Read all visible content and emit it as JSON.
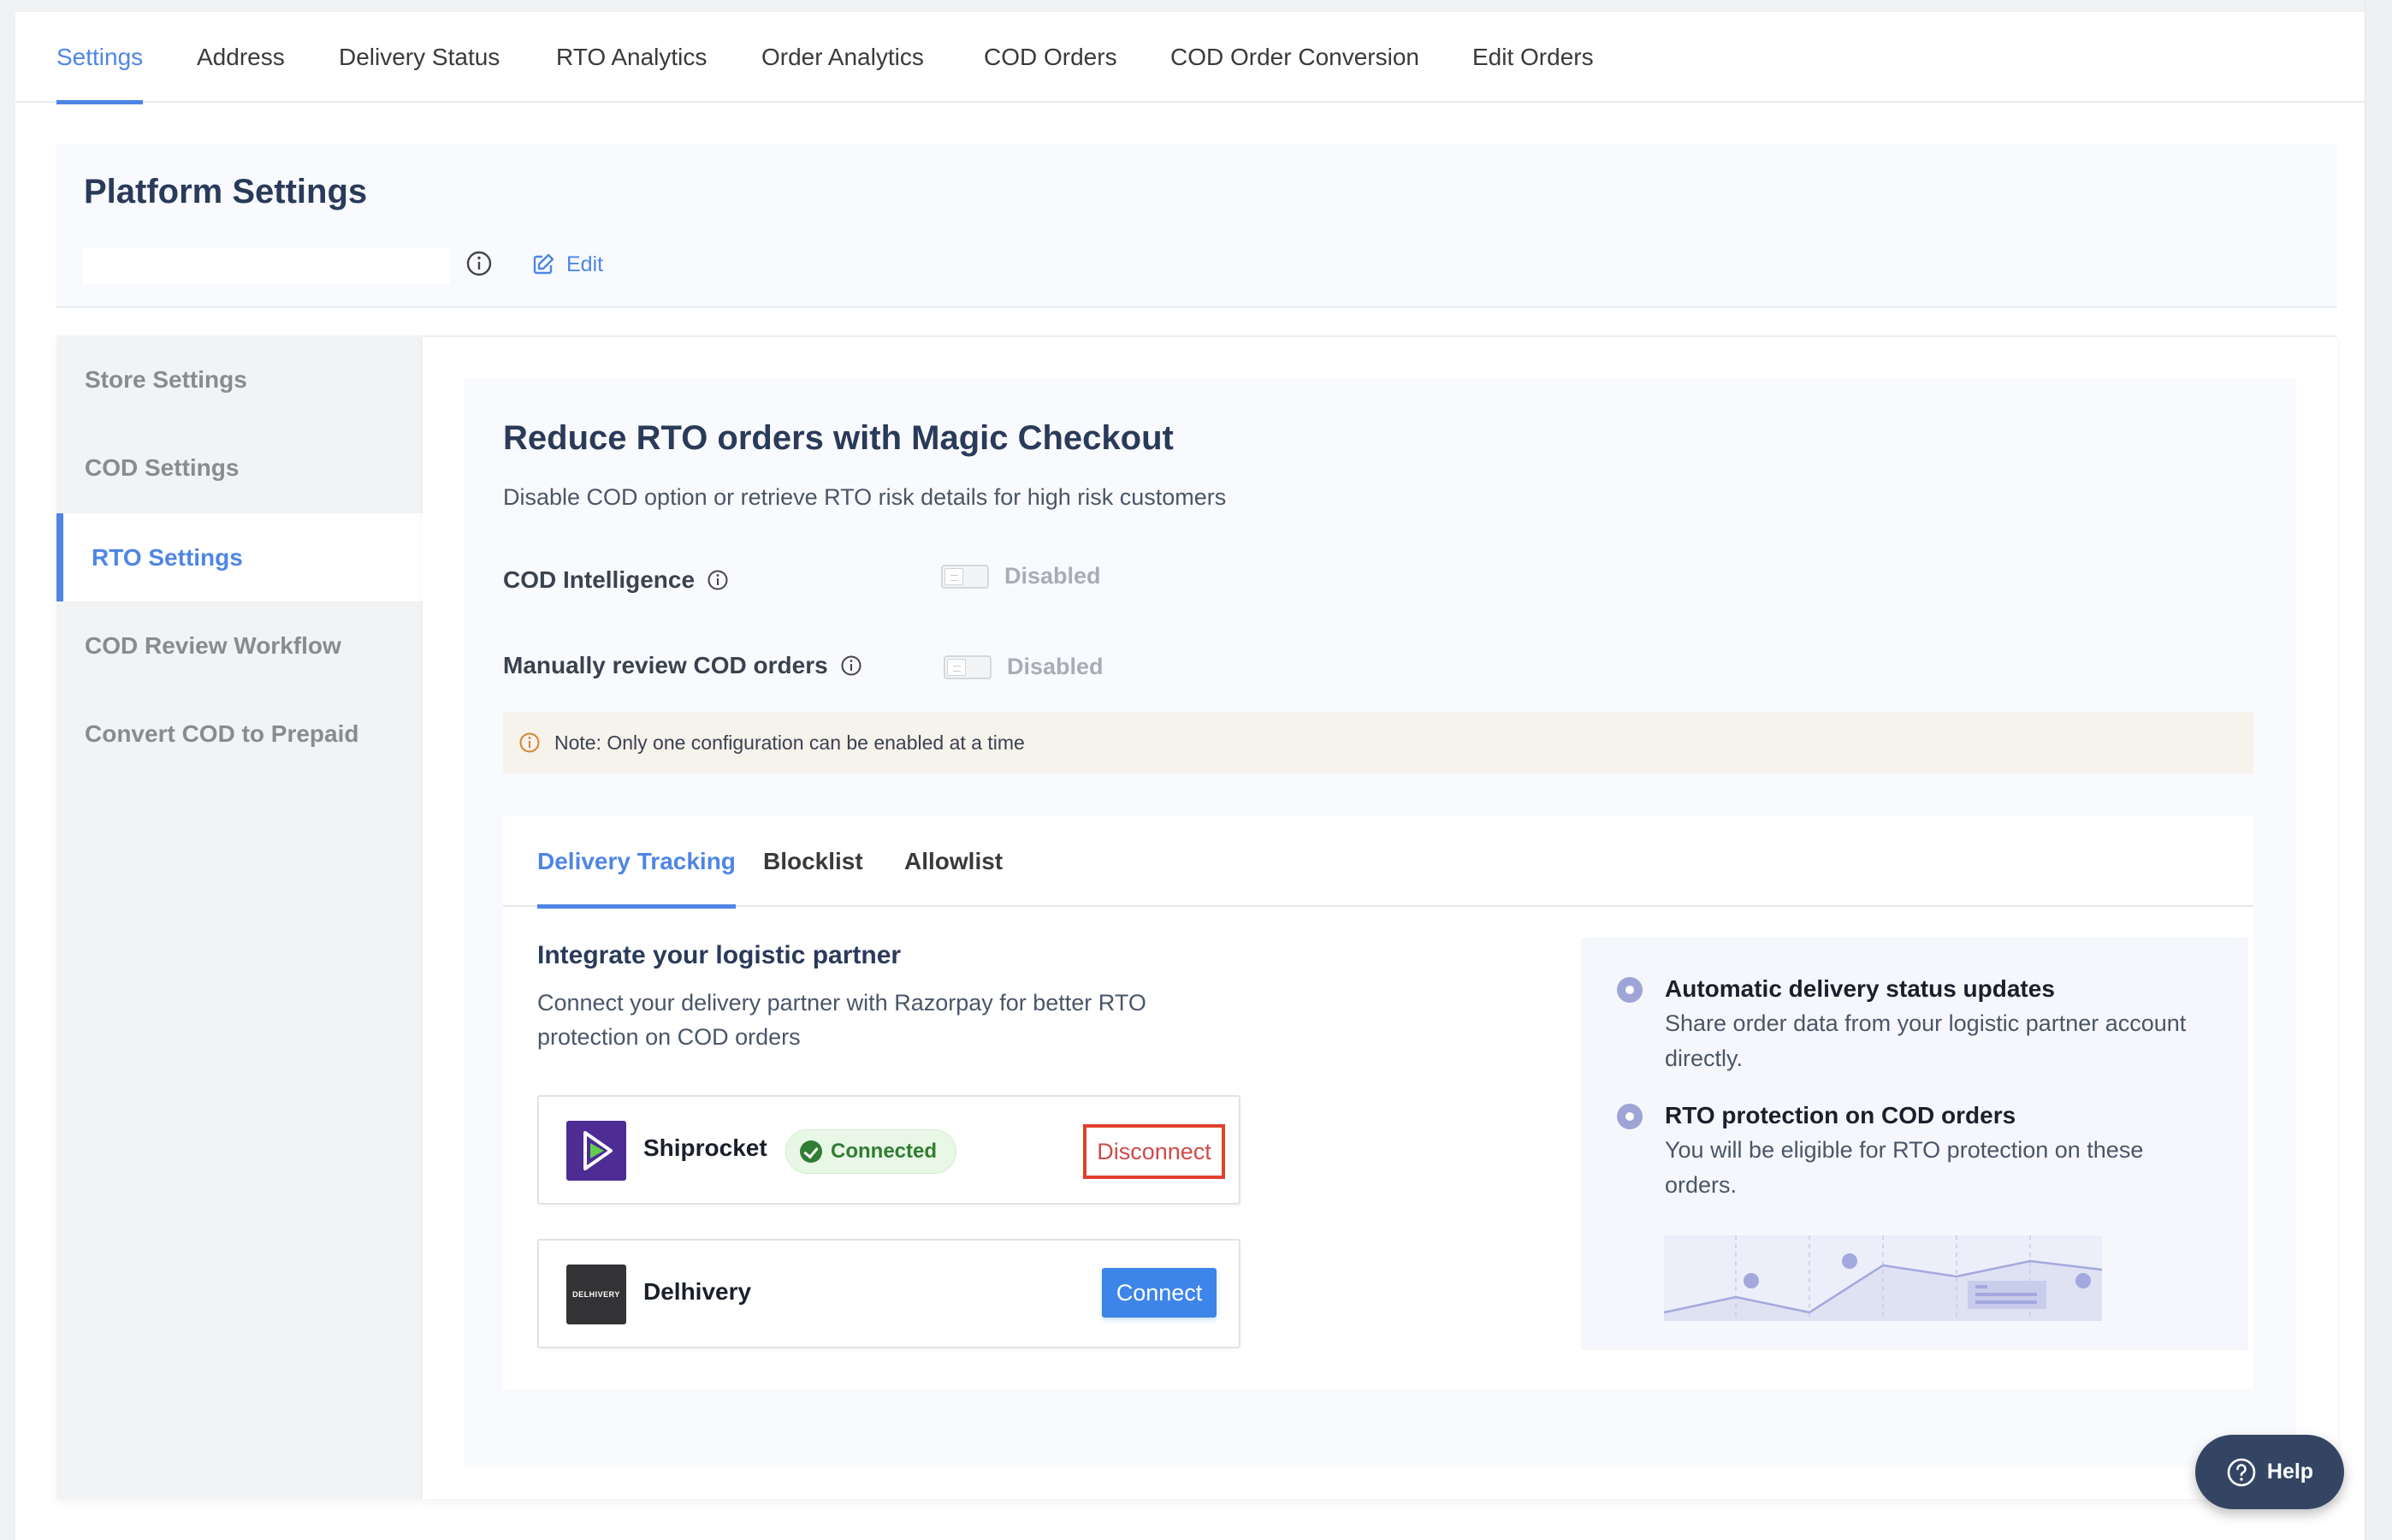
{
  "top_nav": {
    "items": [
      {
        "label": "Settings",
        "active": true
      },
      {
        "label": "Address",
        "active": false
      },
      {
        "label": "Delivery Status",
        "active": false
      },
      {
        "label": "RTO Analytics",
        "active": false
      },
      {
        "label": "Order Analytics",
        "active": false
      },
      {
        "label": "COD Orders",
        "active": false
      },
      {
        "label": "COD Order Conversion",
        "active": false
      },
      {
        "label": "Edit Orders",
        "active": false
      }
    ]
  },
  "header": {
    "title": "Platform Settings",
    "name_field_value": "",
    "edit_label": "Edit"
  },
  "sidebar": {
    "items": [
      {
        "label": "Store Settings",
        "active": false
      },
      {
        "label": "COD Settings",
        "active": false
      },
      {
        "label": "RTO Settings",
        "active": true
      },
      {
        "label": "COD Review Workflow",
        "active": false
      },
      {
        "label": "Convert COD to Prepaid",
        "active": false
      }
    ]
  },
  "rto": {
    "title": "Reduce RTO orders with Magic Checkout",
    "subtitle": "Disable COD option or retrieve RTO risk details for high risk customers",
    "settings": [
      {
        "label": "COD Intelligence",
        "state": "Disabled",
        "enabled": false
      },
      {
        "label": "Manually review COD orders",
        "state": "Disabled",
        "enabled": false
      }
    ],
    "note": "Note: Only one configuration can be enabled at a time"
  },
  "tabs": {
    "items": [
      {
        "label": "Delivery Tracking",
        "active": true
      },
      {
        "label": "Blocklist",
        "active": false
      },
      {
        "label": "Allowlist",
        "active": false
      }
    ]
  },
  "delivery_tracking": {
    "title": "Integrate your logistic partner",
    "description": "Connect your delivery partner with Razorpay for better RTO protection on COD orders",
    "partners": [
      {
        "name": "Shiprocket",
        "logo_icon": "shiprocket-logo",
        "status": "Connected",
        "action": "Disconnect"
      },
      {
        "name": "Delhivery",
        "logo_icon": "delhivery-logo",
        "logo_text": "DELHIVERY",
        "status": "",
        "action": "Connect"
      }
    ],
    "benefits": [
      {
        "title": "Automatic delivery status updates",
        "description": "Share order data from your logistic partner account directly."
      },
      {
        "title": "RTO protection on COD orders",
        "description": "You will be eligible for RTO protection on these orders."
      }
    ]
  },
  "help": {
    "label": "Help"
  },
  "colors": {
    "accent": "#4f86e5",
    "primary_button": "#3d85e8",
    "danger": "#e0402e",
    "success": "#2f7d32",
    "help_button": "#344563",
    "heading": "#2a3a5a"
  }
}
